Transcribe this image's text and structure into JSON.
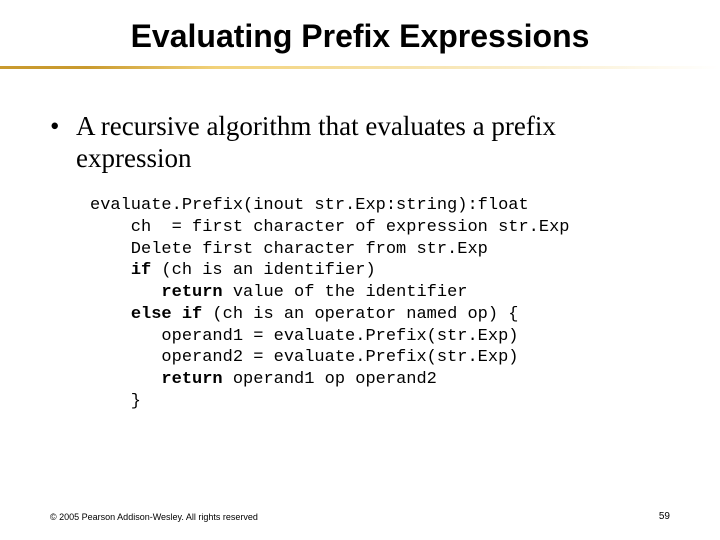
{
  "title": "Evaluating Prefix Expressions",
  "bullet": "A recursive algorithm that evaluates a prefix expression",
  "code": {
    "l1": "evaluate.Prefix(inout str.Exp:string):float",
    "l2": "    ch  = first character of expression str.Exp",
    "l3": "    Delete first character from str.Exp",
    "l4a": "    ",
    "l4kw": "if",
    "l4b": " (ch is an identifier)",
    "l5a": "       ",
    "l5kw": "return",
    "l5b": " value of the identifier",
    "l6a": "    ",
    "l6kw1": "else",
    "l6s": " ",
    "l6kw2": "if",
    "l6b": " (ch is an operator named op) {",
    "l7": "       operand1 = evaluate.Prefix(str.Exp)",
    "l8": "       operand2 = evaluate.Prefix(str.Exp)",
    "l9a": "       ",
    "l9kw": "return",
    "l9b": " operand1 op operand2",
    "l10": "    }"
  },
  "footer": "© 2005 Pearson Addison-Wesley. All rights reserved",
  "pagenum": "59"
}
